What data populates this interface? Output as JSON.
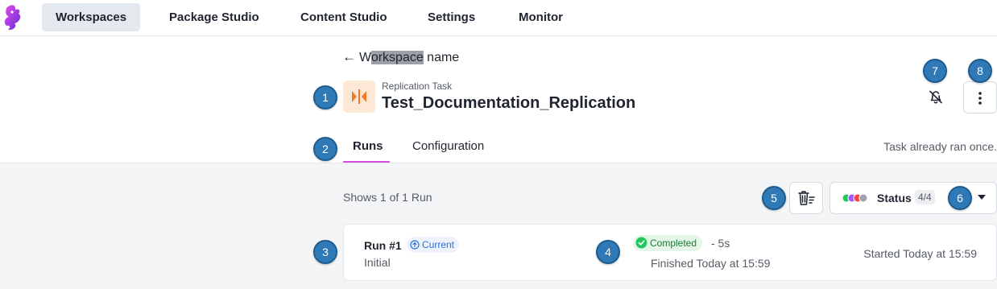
{
  "nav": {
    "items": [
      {
        "label": "Workspaces",
        "active": true
      },
      {
        "label": "Package Studio",
        "active": false
      },
      {
        "label": "Content Studio",
        "active": false
      },
      {
        "label": "Settings",
        "active": false
      },
      {
        "label": "Monitor",
        "active": false
      }
    ]
  },
  "header": {
    "back_arrow": "←",
    "back_prefix": "W",
    "back_highlight": "orkspace",
    "back_suffix": " name",
    "task_type": "Replication Task",
    "task_name": "Test_Documentation_Replication",
    "task_icon": "replication-icon",
    "bell_icon": "bell-off-icon",
    "more_icon": "more-vertical-icon"
  },
  "tabs": [
    {
      "label": "Runs",
      "active": true
    },
    {
      "label": "Configuration",
      "active": false
    }
  ],
  "task_status_note": "Task already ran once.",
  "runs_summary": "Shows 1 of 1 Run",
  "status_filter": {
    "label": "Status",
    "count": "4/4",
    "dot_colors": [
      "#22c55e",
      "#a855f7",
      "#ef4444",
      "#9ca3af"
    ]
  },
  "runs": [
    {
      "title": "Run #1",
      "badge": "Current",
      "subtitle": "Initial",
      "status": "Completed",
      "duration": "- 5s",
      "finished": "Finished Today at 15:59",
      "started": "Started Today at 15:59"
    }
  ],
  "callouts": [
    "1",
    "2",
    "3",
    "4",
    "5",
    "6",
    "7",
    "8"
  ],
  "colors": {
    "accent_tab": "#d64fd9",
    "callout": "#2f7ab6",
    "task_icon_bg": "#fde8d5",
    "task_icon_fg": "#f07a2a",
    "completed_green": "#22c55e"
  }
}
